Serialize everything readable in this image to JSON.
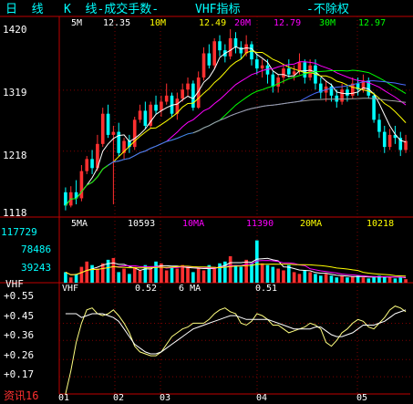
{
  "header": {
    "period_label": "日  线",
    "k_label": "K  线-成交手数-",
    "indicator_label": "VHF指标",
    "adjust_label": "-不除权"
  },
  "price_panel": {
    "ma": [
      {
        "label": "5M",
        "value": "12.35",
        "color": "#ffffff"
      },
      {
        "label": "10M",
        "value": "12.49",
        "color": "#ffff00"
      },
      {
        "label": "20M",
        "value": "12.79",
        "color": "#ff00ff"
      },
      {
        "label": "30M",
        "value": "12.97",
        "color": "#00ff00"
      }
    ],
    "y_labels": [
      "1420",
      "1319",
      "1218",
      "1118"
    ]
  },
  "volume_panel": {
    "ma": [
      {
        "label": "5",
        "ma": "MA",
        "value": "10593",
        "color": "#ffffff",
        "ma_color": "#ffffff"
      },
      {
        "label": "10",
        "ma": "MA",
        "value": "11390",
        "color": "#ff00ff",
        "ma_color": "#ff00ff"
      },
      {
        "label": "20",
        "ma": "MA",
        "value": "10218",
        "color": "#ffff00",
        "ma_color": "#ffff00"
      }
    ],
    "y_labels": [
      "117729",
      "78486",
      "39243"
    ]
  },
  "vhf_panel": {
    "name": "VHF",
    "side_label": "VHF",
    "ma_label": "6",
    "ma_suffix": "MA",
    "value1": "0.52",
    "value2": "0.51",
    "y_labels": [
      "+0.55",
      "+0.45",
      "+0.36",
      "+0.26",
      "+0.17"
    ]
  },
  "x_axis": {
    "labels": [
      "01",
      "02",
      "03",
      "04",
      "05"
    ]
  },
  "footer": {
    "source": "资讯16"
  },
  "colors": {
    "up": "#ff3030",
    "down": "#00ffff",
    "axis": "#c00000",
    "ma5": "#ffffff",
    "ma10": "#ffff00",
    "ma20": "#ff00ff",
    "ma30": "#00ff00",
    "ma60": "#4a6cff",
    "ma120": "#a0a0a0"
  },
  "chart_data": {
    "type": "candlestick",
    "price_ylim": [
      1118,
      1420
    ],
    "candles": [
      [
        1150,
        1128,
        1158,
        1120
      ],
      [
        1128,
        1150,
        1160,
        1125
      ],
      [
        1150,
        1140,
        1170,
        1130
      ],
      [
        1140,
        1185,
        1195,
        1135
      ],
      [
        1185,
        1205,
        1210,
        1180
      ],
      [
        1205,
        1190,
        1220,
        1180
      ],
      [
        1190,
        1230,
        1245,
        1185
      ],
      [
        1230,
        1280,
        1290,
        1225
      ],
      [
        1280,
        1245,
        1295,
        1240
      ],
      [
        1245,
        1250,
        1260,
        1130
      ],
      [
        1250,
        1215,
        1265,
        1210
      ],
      [
        1215,
        1235,
        1240,
        1205
      ],
      [
        1235,
        1225,
        1245,
        1215
      ],
      [
        1225,
        1270,
        1275,
        1220
      ],
      [
        1270,
        1285,
        1295,
        1265
      ],
      [
        1285,
        1260,
        1300,
        1255
      ],
      [
        1260,
        1295,
        1300,
        1255
      ],
      [
        1295,
        1285,
        1310,
        1280
      ],
      [
        1285,
        1300,
        1310,
        1275
      ],
      [
        1300,
        1310,
        1330,
        1295
      ],
      [
        1310,
        1280,
        1315,
        1275
      ],
      [
        1280,
        1305,
        1315,
        1270
      ],
      [
        1305,
        1320,
        1330,
        1300
      ],
      [
        1320,
        1330,
        1340,
        1310
      ],
      [
        1330,
        1290,
        1335,
        1285
      ],
      [
        1290,
        1340,
        1350,
        1288
      ],
      [
        1340,
        1380,
        1390,
        1335
      ],
      [
        1380,
        1360,
        1395,
        1355
      ],
      [
        1360,
        1400,
        1405,
        1355
      ],
      [
        1400,
        1385,
        1410,
        1375
      ],
      [
        1385,
        1375,
        1395,
        1365
      ],
      [
        1375,
        1405,
        1420,
        1370
      ],
      [
        1405,
        1390,
        1415,
        1380
      ],
      [
        1390,
        1380,
        1400,
        1370
      ],
      [
        1380,
        1395,
        1410,
        1375
      ],
      [
        1395,
        1370,
        1400,
        1360
      ],
      [
        1370,
        1355,
        1380,
        1345
      ],
      [
        1355,
        1360,
        1370,
        1340
      ],
      [
        1360,
        1345,
        1370,
        1330
      ],
      [
        1345,
        1325,
        1350,
        1315
      ],
      [
        1325,
        1340,
        1345,
        1315
      ],
      [
        1340,
        1355,
        1360,
        1330
      ],
      [
        1355,
        1345,
        1370,
        1340
      ],
      [
        1345,
        1350,
        1360,
        1335
      ],
      [
        1350,
        1365,
        1380,
        1345
      ],
      [
        1365,
        1340,
        1370,
        1330
      ],
      [
        1340,
        1360,
        1370,
        1335
      ],
      [
        1360,
        1330,
        1370,
        1320
      ],
      [
        1330,
        1315,
        1340,
        1305
      ],
      [
        1315,
        1325,
        1335,
        1300
      ],
      [
        1325,
        1310,
        1330,
        1300
      ],
      [
        1310,
        1300,
        1320,
        1290
      ],
      [
        1300,
        1320,
        1330,
        1295
      ],
      [
        1320,
        1310,
        1325,
        1300
      ],
      [
        1310,
        1330,
        1340,
        1305
      ],
      [
        1330,
        1320,
        1340,
        1310
      ],
      [
        1320,
        1335,
        1345,
        1315
      ],
      [
        1335,
        1310,
        1340,
        1305
      ],
      [
        1310,
        1270,
        1315,
        1265
      ],
      [
        1270,
        1250,
        1280,
        1240
      ],
      [
        1250,
        1225,
        1260,
        1215
      ],
      [
        1225,
        1245,
        1255,
        1220
      ],
      [
        1245,
        1240,
        1260,
        1230
      ],
      [
        1240,
        1220,
        1250,
        1210
      ],
      [
        1220,
        1235,
        1245,
        1215
      ]
    ],
    "volume_ylim": [
      0,
      150000
    ],
    "volumes": [
      30000,
      15000,
      25000,
      45000,
      60000,
      50000,
      40000,
      55000,
      65000,
      70000,
      30000,
      40000,
      25000,
      45000,
      35000,
      50000,
      40000,
      60000,
      55000,
      35000,
      45000,
      40000,
      50000,
      45000,
      30000,
      40000,
      35000,
      50000,
      45000,
      55000,
      60000,
      75000,
      50000,
      45000,
      65000,
      55000,
      120000,
      55000,
      50000,
      45000,
      40000,
      35000,
      50000,
      30000,
      25000,
      35000,
      30000,
      25000,
      20000,
      25000,
      20000,
      15000,
      20000,
      15000,
      18000,
      20000,
      15000,
      12000,
      15000,
      20000,
      18000,
      15000,
      12000,
      15000,
      10000
    ],
    "vhf_ylim": [
      0.08,
      0.6
    ],
    "vhf": [
      0.08,
      0.2,
      0.35,
      0.45,
      0.52,
      0.53,
      0.5,
      0.49,
      0.5,
      0.52,
      0.49,
      0.45,
      0.4,
      0.33,
      0.3,
      0.29,
      0.28,
      0.28,
      0.3,
      0.34,
      0.38,
      0.4,
      0.42,
      0.43,
      0.45,
      0.45,
      0.45,
      0.47,
      0.5,
      0.52,
      0.53,
      0.51,
      0.5,
      0.45,
      0.44,
      0.46,
      0.5,
      0.49,
      0.47,
      0.44,
      0.44,
      0.42,
      0.4,
      0.41,
      0.42,
      0.43,
      0.45,
      0.44,
      0.42,
      0.35,
      0.33,
      0.36,
      0.4,
      0.42,
      0.45,
      0.47,
      0.46,
      0.43,
      0.42,
      0.45,
      0.48,
      0.52,
      0.54,
      0.53,
      0.51
    ],
    "vhf_ma": [
      0.5,
      0.5,
      0.5,
      0.48,
      0.49,
      0.5,
      0.5,
      0.5,
      0.49,
      0.48,
      0.46,
      0.42,
      0.38,
      0.34,
      0.32,
      0.3,
      0.29,
      0.29,
      0.3,
      0.32,
      0.34,
      0.36,
      0.38,
      0.4,
      0.42,
      0.43,
      0.44,
      0.45,
      0.46,
      0.47,
      0.48,
      0.49,
      0.49,
      0.48,
      0.47,
      0.47,
      0.47,
      0.47,
      0.47,
      0.46,
      0.45,
      0.44,
      0.43,
      0.42,
      0.42,
      0.42,
      0.42,
      0.43,
      0.43,
      0.41,
      0.39,
      0.38,
      0.38,
      0.39,
      0.4,
      0.42,
      0.44,
      0.44,
      0.44,
      0.45,
      0.46,
      0.48,
      0.5,
      0.51,
      0.52
    ]
  }
}
